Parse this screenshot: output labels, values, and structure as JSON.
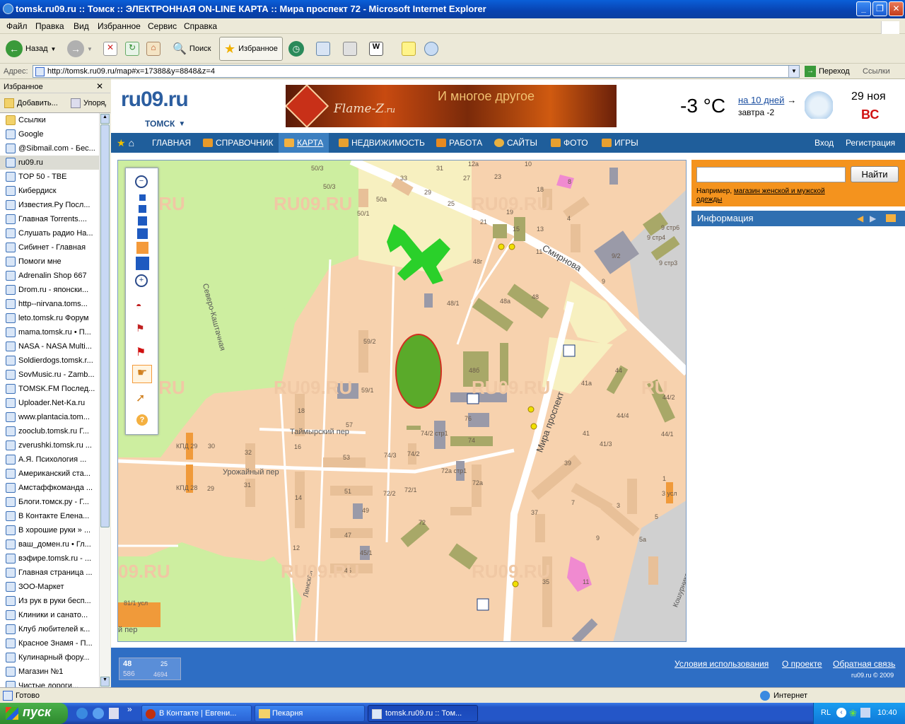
{
  "window": {
    "title": "tomsk.ru09.ru :: Томск :: ЭЛЕКТРОННАЯ ON-LINE КАРТА :: Мира проспект 72 - Microsoft Internet Explorer"
  },
  "menu": [
    "Файл",
    "Правка",
    "Вид",
    "Избранное",
    "Сервис",
    "Справка"
  ],
  "toolbar": {
    "back": "Назад",
    "search": "Поиск",
    "favorites": "Избранное"
  },
  "address": {
    "label": "Адрес:",
    "url": "http://tomsk.ru09.ru/map#x=17388&y=8848&z=4",
    "go": "Переход",
    "links": "Ссылки"
  },
  "sidebar": {
    "title": "Избранное",
    "add": "Добавить...",
    "organize": "Упорядочить...",
    "items": [
      "Ссылки",
      "Google",
      "@Sibmail.com - Бес...",
      "ru09.ru",
      "TOP 50 - TBE",
      "Кибердиск",
      "Известия.Ру Посл...",
      "Главная  Torrents....",
      "Слушать радио На...",
      "Сибинет - Главная",
      "Помоги мне",
      "Adrenalin Shop 667",
      "Drom.ru - японски...",
      "http--nirvana.toms...",
      "leto.tomsk.ru  Форум",
      "mama.tomsk.ru • П...",
      "NASA - NASA Multi...",
      "Soldierdogs.tomsk.r...",
      "SovMusic.ru - Zamb...",
      "TOMSK.FM  Послед...",
      "Uploader.Net-Ka.ru",
      "www.plantacia.tom...",
      "zooclub.tomsk.ru  Г...",
      "zverushki.tomsk.ru ...",
      "А.Я. Психология ...",
      "Американский ста...",
      "Амстаффкоманда ...",
      "Блоги.томск.ру - Г...",
      "В Контакте  Елена...",
      "В хорошие руки » ...",
      "ваш_домен.ru • Гл...",
      "вэфире.tomsk.ru - ...",
      "Главная страница ...",
      "ЗОО-Маркет",
      "Из рук в руки бесп...",
      "Клиники и санато...",
      "Клуб любителей к...",
      "Красное Знамя - П...",
      "Кулинарный фору...",
      "Магазин №1",
      "Чистые дороги..."
    ]
  },
  "site": {
    "logo": "ru09.ru",
    "city": "ТОМСК",
    "banner_brand": "Flame-Z",
    "banner_tld": ".ru",
    "banner_text": "И многое другое",
    "temp": "-3 °C",
    "forecast_link": "на 10 дней",
    "tomorrow": "завтра -2",
    "date": "29 ноя",
    "weekday": "ВС",
    "nav": [
      "ГЛАВНАЯ",
      "СПРАВОЧНИК",
      "КАРТА",
      "НЕДВИЖИМОСТЬ",
      "РАБОТА",
      "САЙТЫ",
      "ФОТО",
      "ИГРЫ"
    ],
    "login": "Вход",
    "register": "Регистрация",
    "search_button": "Найти",
    "search_hint_prefix": "Например, ",
    "search_hint_link": "магазин женской и мужской одежды",
    "info": "Информация",
    "footer_links": [
      "Условия использования",
      "О проекте",
      "Обратная связь"
    ],
    "copyright": "ru09.ru © 2009",
    "counter": {
      "a": "48",
      "b": "25",
      "c": "586",
      "d": "4694"
    }
  },
  "map": {
    "streets": [
      "Смирнова",
      "Мира проспект",
      "Таймырский пер",
      "Урожайный пер",
      "Северо-Каштачная",
      "Ленская",
      "Кошурникова",
      "й пер"
    ],
    "buildings": [
      "50/3",
      "50/3",
      "33",
      "31",
      "12а",
      "27",
      "23",
      "10",
      "18",
      "29",
      "25",
      "21",
      "19",
      "15",
      "13",
      "4",
      "9 стр6",
      "9 стр4",
      "9/2",
      "9 стр3",
      "9",
      "50/1",
      "50а",
      "48г",
      "48/1",
      "48",
      "48а",
      "11",
      "59/2",
      "48б",
      "59/1",
      "18",
      "57",
      "16",
      "30",
      "32",
      "74/2 стр1",
      "74",
      "76",
      "53",
      "74/3",
      "74/2",
      "72а стр1",
      "72а",
      "44",
      "41а",
      "44/4",
      "44/2",
      "44/1",
      "41",
      "41/3",
      "39",
      "7",
      "3",
      "1",
      "3 усл",
      "КПД 29",
      "КПД 28",
      "29",
      "31",
      "14",
      "51",
      "72/2",
      "72/1",
      "49",
      "72",
      "47",
      "45/1",
      "45",
      "12",
      "37",
      "5",
      "5а",
      "9",
      "35",
      "11",
      "81/1 усл",
      "8",
      "50а"
    ]
  },
  "status": {
    "text": "Готово",
    "zone": "Интернет"
  },
  "taskbar": {
    "start": "пуск",
    "tasks": [
      "В Контакте | Евгени...",
      "Пекарня",
      "tomsk.ru09.ru :: Том..."
    ],
    "lang": "RL",
    "clock": "10:40"
  }
}
